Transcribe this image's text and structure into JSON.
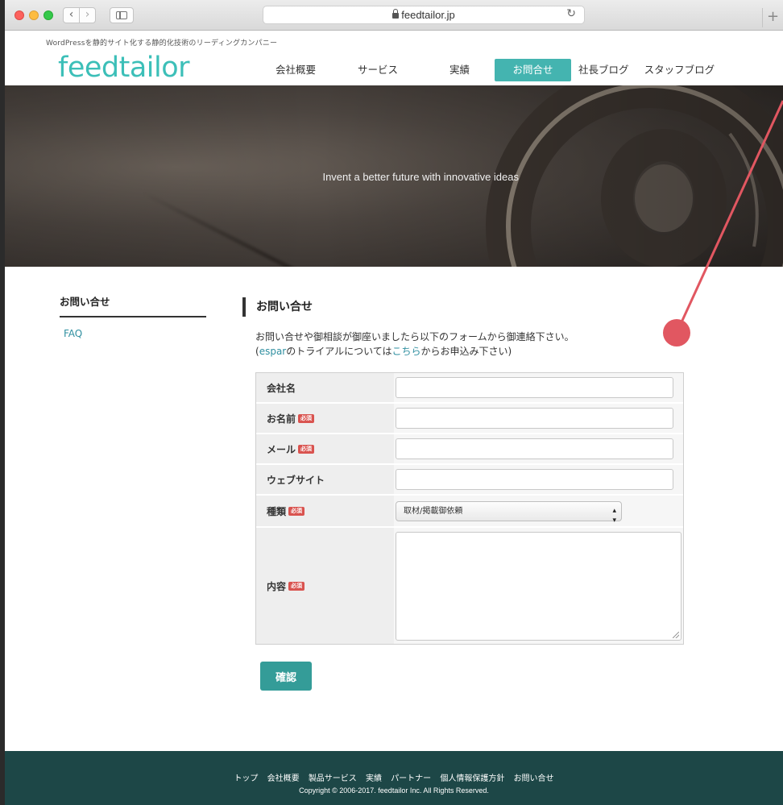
{
  "browser": {
    "url": "feedtailor.jp",
    "back_icon": "chevron-left-icon",
    "forward_icon": "chevron-right-icon",
    "reload_icon": "reload-icon",
    "newtab_label": "+"
  },
  "header": {
    "tagline": "WordPressを静的サイト化する静的化技術のリーディングカンパニー",
    "logo_text": "feedtailor",
    "nav": [
      {
        "label": "会社概要"
      },
      {
        "label": "サービス"
      },
      {
        "label": "実績"
      },
      {
        "label": "お問合せ",
        "active": true
      },
      {
        "label": "社長ブログ"
      },
      {
        "label": "スタッフブログ"
      }
    ]
  },
  "hero": {
    "text": "Invent a better future with innovative ideas"
  },
  "sidebar": {
    "title": "お問い合せ",
    "items": [
      {
        "label": "FAQ"
      }
    ]
  },
  "main": {
    "title": "お問い合せ",
    "intro_line1": "お問い合せや御相談が御座いましたら以下のフォームから御連絡下さい。",
    "intro_line2_open": "(",
    "intro_espar_link": "espar",
    "intro_line2_mid": "のトライアルについては",
    "intro_kochira_link": "こちら",
    "intro_line2_end": "からお申込み下さい)"
  },
  "form": {
    "required_badge": "必須",
    "fields": [
      {
        "label": "会社名",
        "required": false,
        "value": ""
      },
      {
        "label": "お名前",
        "required": true,
        "value": ""
      },
      {
        "label": "メール",
        "required": true,
        "value": ""
      },
      {
        "label": "ウェブサイト",
        "required": false,
        "value": ""
      },
      {
        "label": "種類",
        "required": true,
        "selected": "取材/掲載御依頼"
      },
      {
        "label": "内容",
        "required": true,
        "value": ""
      }
    ],
    "submit_label": "確認"
  },
  "footer": {
    "links": [
      {
        "label": "トップ"
      },
      {
        "label": "会社概要"
      },
      {
        "label": "製品サービス"
      },
      {
        "label": "実績"
      },
      {
        "label": "パートナー"
      },
      {
        "label": "個人情報保護方針"
      },
      {
        "label": "お問い合せ"
      }
    ],
    "copyright": "Copyright © 2006-2017. feedtailor Inc. All Rights Reserved."
  },
  "colors": {
    "brand": "#3cbfb8",
    "nav_active": "#44b4b0",
    "button": "#349c98",
    "footer": "#1d4747",
    "required": "#d9534f",
    "annotation": "#e15761"
  }
}
